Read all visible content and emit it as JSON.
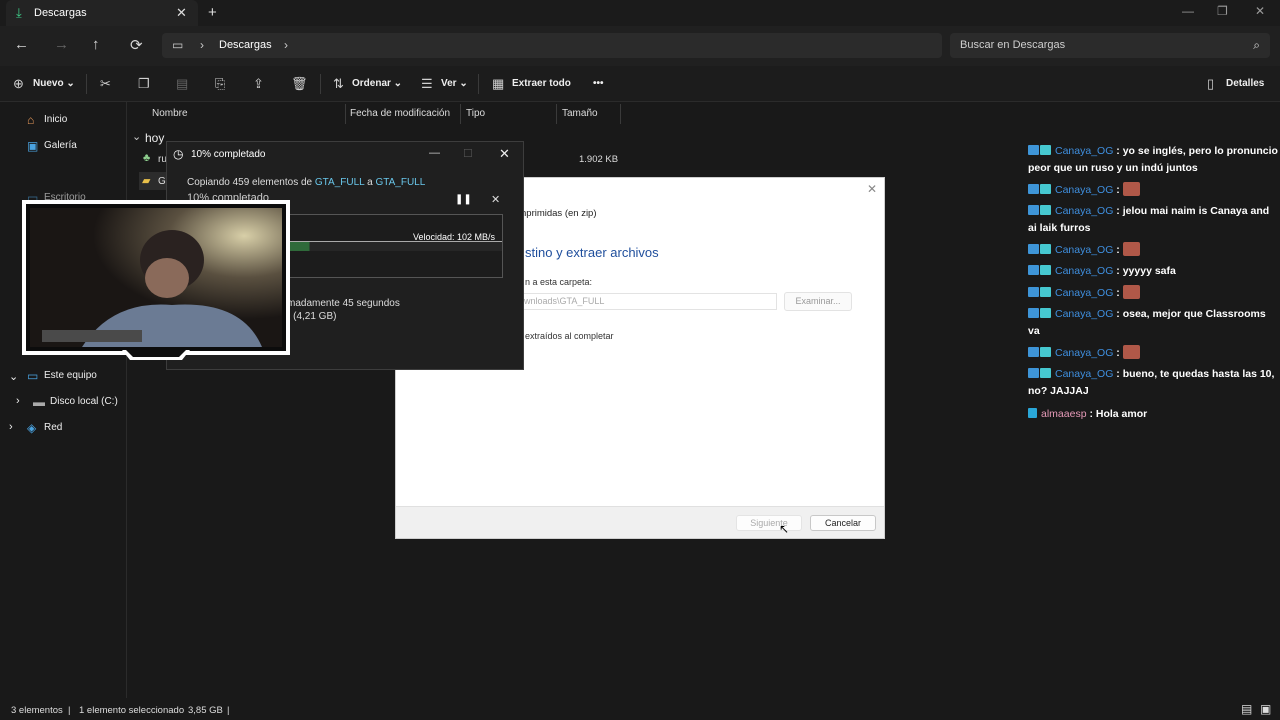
{
  "tab": {
    "title": "Descargas",
    "close": "✕",
    "new_tab": "+"
  },
  "window_controls": {
    "minimize": "—",
    "restore": "❐",
    "close": "✕"
  },
  "nav": {
    "back": "←",
    "forward": "→",
    "up": "↑",
    "refresh": "⟳",
    "location": "Descargas",
    "search_placeholder": "Buscar en Descargas"
  },
  "toolbar": {
    "new_label": "Nuevo",
    "sort_label": "Ordenar",
    "view_label": "Ver",
    "extract_label": "Extraer todo",
    "more": "•••",
    "details_label": "Detalles"
  },
  "sidebar": {
    "items": [
      {
        "label": "Inicio"
      },
      {
        "label": "Galería"
      },
      {
        "label": "Escritorio"
      },
      {
        "label": "Este equipo"
      },
      {
        "label": "Disco local (C:)"
      },
      {
        "label": "Red"
      }
    ]
  },
  "list": {
    "columns": [
      "Nombre",
      "Fecha de modificación",
      "Tipo",
      "Tamaño"
    ],
    "group": "hoy",
    "rows": [
      {
        "name": "ru",
        "size": "1.902 KB"
      },
      {
        "name": "GT",
        "size": ""
      }
    ]
  },
  "copy_dialog": {
    "title": "10% completado",
    "line_prefix": "Copiando 459 elementos de",
    "source": "GTA_FULL",
    "line_mid": "a",
    "target": "GTA_FULL",
    "percent": "10% completado",
    "progress_fraction": 0.1,
    "speed": "Velocidad: 102 MB/s",
    "remaining": "madamente 45 segundos",
    "items_left": ") (4,21 GB)"
  },
  "wizard": {
    "subtitle": "nprimidas (en zip)",
    "heading": "stino y extraer archivos",
    "folder_label": "n a esta carpeta:",
    "path_value": "wnloads\\GTA_FULL",
    "browse": "Examinar...",
    "checkbox_label": "extraídos al completar",
    "next": "Siguiente",
    "cancel": "Cancelar"
  },
  "chat": {
    "messages": [
      {
        "user": "Canaya_OG",
        "text": ": yo se inglés, pero lo pronuncio peor que un ruso y un indú juntos",
        "emote": false
      },
      {
        "user": "Canaya_OG",
        "text": ":",
        "emote": true
      },
      {
        "user": "Canaya_OG",
        "text": ": jelou mai naim is Canaya and ai laik furros",
        "emote": false
      },
      {
        "user": "Canaya_OG",
        "text": ":",
        "emote": true
      },
      {
        "user": "Canaya_OG",
        "text": ": yyyyy safa",
        "emote": false
      },
      {
        "user": "Canaya_OG",
        "text": ":",
        "emote": true
      },
      {
        "user": "Canaya_OG",
        "text": ": osea, mejor que Classrooms va",
        "emote": false
      },
      {
        "user": "Canaya_OG",
        "text": ":",
        "emote": true
      },
      {
        "user": "Canaya_OG",
        "text": ": bueno, te quedas hasta las 10, no? JAJJAJ",
        "emote": false
      },
      {
        "user": "almaaesp",
        "text": ": Hola amor",
        "emote": false
      }
    ]
  },
  "status": {
    "count": "3 elementos",
    "selected": "1 elemento seleccionado",
    "size": "3,85 GB",
    "sep": "|"
  }
}
